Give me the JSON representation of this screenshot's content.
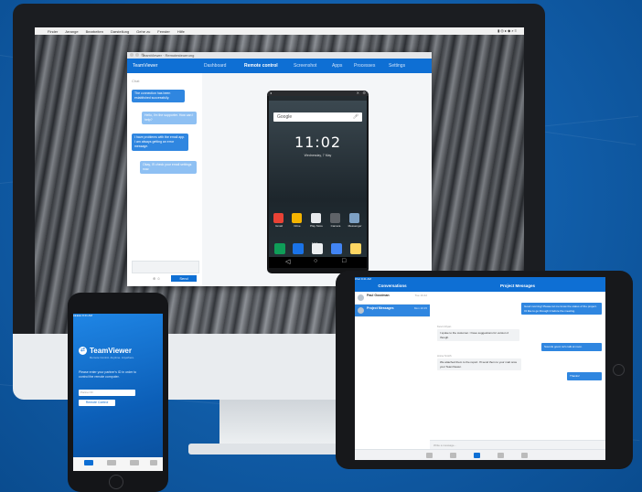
{
  "mac_menubar": {
    "items": [
      "Finder",
      "Arrange",
      "Bearbeiten",
      "Darstellung",
      "Gehe zu",
      "Fenster",
      "Hilfe"
    ],
    "status_right": "▮ ◎ ▸ ◆ ⌕ ≡"
  },
  "desktop_window": {
    "title": "TeamViewer · Remotesteuerung",
    "brand": "TeamViewer",
    "tabs": [
      "Dashboard",
      "Remote control",
      "Screenshot",
      "Apps",
      "Processes",
      "Settings"
    ],
    "active_tab": "Remote control",
    "chat_label": "Chat",
    "chat_messages": [
      {
        "text": "The connection has been established successfully.",
        "dir": "in"
      },
      {
        "text": "Hello, I'm the supporter. How can I help?",
        "dir": "out"
      },
      {
        "text": "I have problems with the email app. I am always getting an error message.",
        "dir": "in"
      },
      {
        "text": "Okay, I'll check your email settings now.",
        "dir": "out"
      }
    ],
    "send_label": "Send"
  },
  "android_phone": {
    "search_placeholder": "Google",
    "time": "11:02",
    "date": "Wednesday, 7 May",
    "apps": [
      "Gmail",
      "Drive",
      "Play Store",
      "Camera",
      "Messenger"
    ],
    "nav_icons": [
      "◁",
      "○",
      "□"
    ]
  },
  "iphone": {
    "status": "●●●●● 9:41 AM",
    "app_name": "TeamViewer",
    "tagline": "Remote Control. Anytime. Anywhere.",
    "description": "Please enter your partner's ID in order to control the remote computer.",
    "id_placeholder": "Partner ID",
    "button_label": "Remote Control"
  },
  "ipad": {
    "status": "iPad   9:41 AM",
    "left_header": "Conversations",
    "right_header": "Project Messages",
    "conversations": [
      {
        "name": "Paul Goodman",
        "time": "Tue 16:42",
        "selected": false
      },
      {
        "name": "Project Messages",
        "time": "Mon 10:15",
        "selected": true
      }
    ],
    "messages": [
      {
        "text": "Good morning! Please let me know the status of the project. I'd like to go through it before the meeting.",
        "who": "me"
      },
      {
        "meta": "Kevin Ryan",
        "text": "I spoke to the customer. I have suggestions for version 2 though.",
        "who": "them"
      },
      {
        "text": "Sounds good, let's talk at noon.",
        "who": "me"
      },
      {
        "meta": "Anna Smith",
        "text": "We attached them to the report. I'll send them to your mail once your TeamViewer.",
        "who": "them"
      },
      {
        "text": "Thanks!",
        "who": "me"
      }
    ],
    "input_placeholder": "Write a message..."
  },
  "colors": {
    "teamviewer_blue": "#0e6fd4",
    "bubble_in": "#2f86e0",
    "bubble_out": "#8ec0f3",
    "background_blue": "#1260ad"
  }
}
